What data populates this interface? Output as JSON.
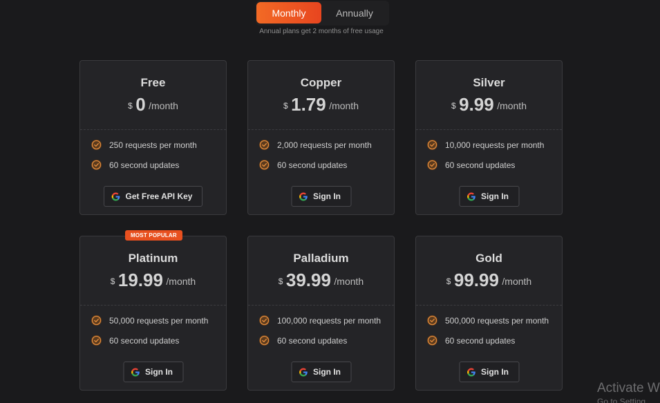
{
  "billing_toggle": {
    "monthly_label": "Monthly",
    "annually_label": "Annually",
    "note": "Annual plans get 2 months of free usage"
  },
  "plans": [
    {
      "name": "Free",
      "currency": "$",
      "price": "0",
      "period": "/month",
      "features": [
        "250 requests per month",
        "60 second updates"
      ],
      "cta": "Get Free API Key"
    },
    {
      "name": "Copper",
      "currency": "$",
      "price": "1.79",
      "period": "/month",
      "features": [
        "2,000 requests per month",
        "60 second updates"
      ],
      "cta": "Sign In"
    },
    {
      "name": "Silver",
      "currency": "$",
      "price": "9.99",
      "period": "/month",
      "features": [
        "10,000 requests per month",
        "60 second updates"
      ],
      "cta": "Sign In"
    },
    {
      "name": "Platinum",
      "currency": "$",
      "price": "19.99",
      "period": "/month",
      "badge": "MOST POPULAR",
      "features": [
        "50,000 requests per month",
        "60 second updates"
      ],
      "cta": "Sign In"
    },
    {
      "name": "Palladium",
      "currency": "$",
      "price": "39.99",
      "period": "/month",
      "features": [
        "100,000 requests per month",
        "60 second updates"
      ],
      "cta": "Sign In"
    },
    {
      "name": "Gold",
      "currency": "$",
      "price": "99.99",
      "period": "/month",
      "features": [
        "500,000 requests per month",
        "60 second updates"
      ],
      "cta": "Sign In"
    }
  ],
  "watermark": {
    "line1": "Activate W",
    "line2": "Go to Setting"
  },
  "colors": {
    "accent": "#f26a25",
    "accent_dark": "#e8451f",
    "background": "#1a1a1c",
    "card": "#242427",
    "check_ring": "#e08a3c"
  },
  "icons": {
    "feature": "check-circle-icon",
    "cta": "google-icon"
  }
}
